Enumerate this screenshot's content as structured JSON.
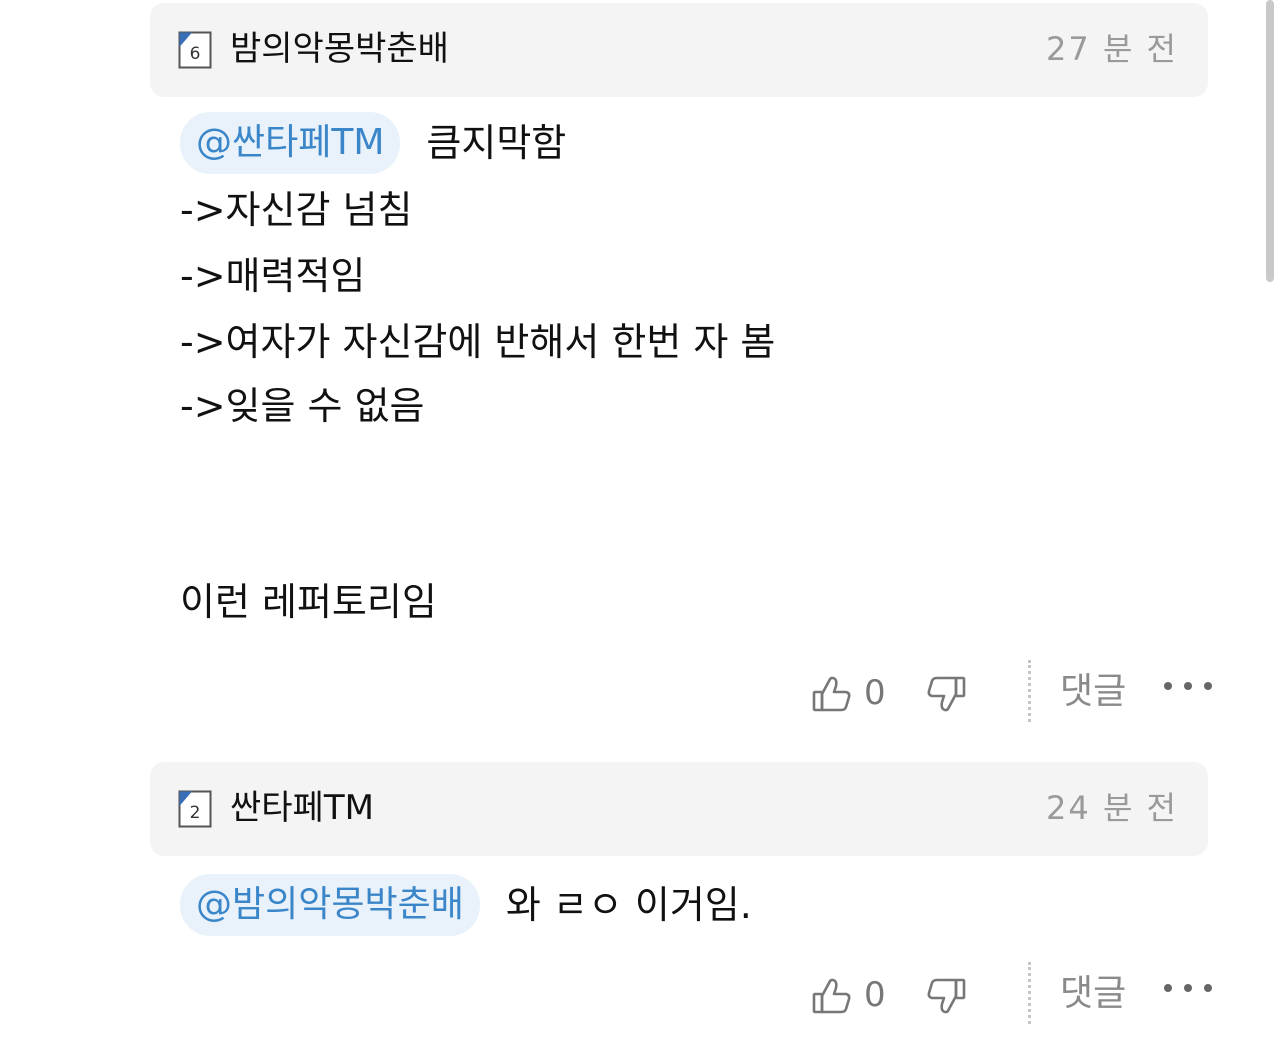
{
  "comments": [
    {
      "level": "6",
      "username": "밤의악몽박춘배",
      "timestamp": "27 분 전",
      "mention": "@싼타페TM",
      "first_line": "큼지막함",
      "lines": [
        "->자신감 넘침",
        "->매력적임",
        "->여자가 자신감에 반해서 한번 자 봄",
        "->잊을 수 없음"
      ],
      "closing_line": "이런 레퍼토리임",
      "like_count": "0",
      "reply_label": "댓글"
    },
    {
      "level": "2",
      "username": "싼타페TM",
      "timestamp": "24 분 전",
      "mention": "@밤의악몽박춘배",
      "first_line": "와 ㄹㅇ 이거임.",
      "like_count": "0",
      "reply_label": "댓글"
    }
  ],
  "icons": {
    "level": "level-badge-icon",
    "like": "thumbs-up-icon",
    "dislike": "thumbs-down-icon",
    "more": "more-horizontal-icon"
  },
  "colors": {
    "mention_text": "#3b86c9",
    "mention_bg": "#e9f2fb",
    "header_bg": "#f4f4f4",
    "level_accent": "#3a6fb7"
  }
}
